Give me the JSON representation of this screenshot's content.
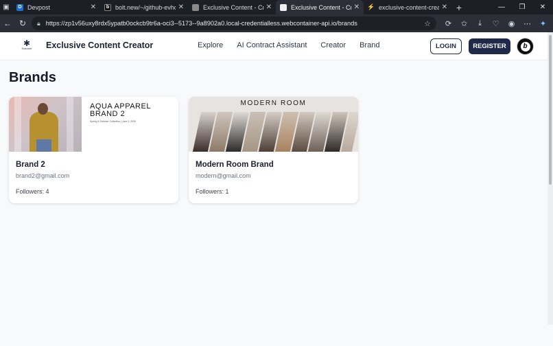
{
  "browser": {
    "tabs": [
      {
        "label": "Devpost",
        "fav": "D",
        "fav_color": "#1b6fd1",
        "active": false
      },
      {
        "label": "bolt.new/~/github-evhcvc",
        "fav": "b",
        "fav_color": "#111111",
        "active": false
      },
      {
        "label": "Exclusive Content - Creato",
        "fav": "",
        "fav_color": "#888888",
        "active": false
      },
      {
        "label": "Exclusive Content - Creato",
        "fav": "",
        "fav_color": "#eeeeee",
        "active": true
      },
      {
        "label": "exclusive-content-creator |",
        "fav": "⚡",
        "fav_color": "#2bbf5e",
        "active": false
      }
    ],
    "url": "https://zp1v56uxy8rdx5ypatb0ockcb9tr6a-oci3--5173--9a8902a0.local-credentialless.webcontainer-api.io/brands"
  },
  "site": {
    "logo_caption": "Exclusive",
    "name": "Exclusive Content Creator",
    "nav": [
      "Explore",
      "AI Contract Assistant",
      "Creator",
      "Brand"
    ],
    "login_label": "LOGIN",
    "register_label": "REGISTER",
    "avatar_letter": "b"
  },
  "page": {
    "title": "Brands",
    "brands": [
      {
        "name": "Brand 2",
        "email": "brand2@gmail.com",
        "followers": "Followers: 4",
        "image_headline_1": "AQUA APPAREL",
        "image_headline_2": "BRAND 2",
        "image_sub": "Spring & Summer Collection | June 2, 2030"
      },
      {
        "name": "Modern Room Brand",
        "email": "modern@gmail.com",
        "followers": "Followers: 1",
        "image_headline": "MODERN ROOM"
      }
    ]
  },
  "colors": {
    "accent": "#1f2a4a",
    "tabstrip": "#1c1f26",
    "page_bg": "#f8f9fb"
  }
}
